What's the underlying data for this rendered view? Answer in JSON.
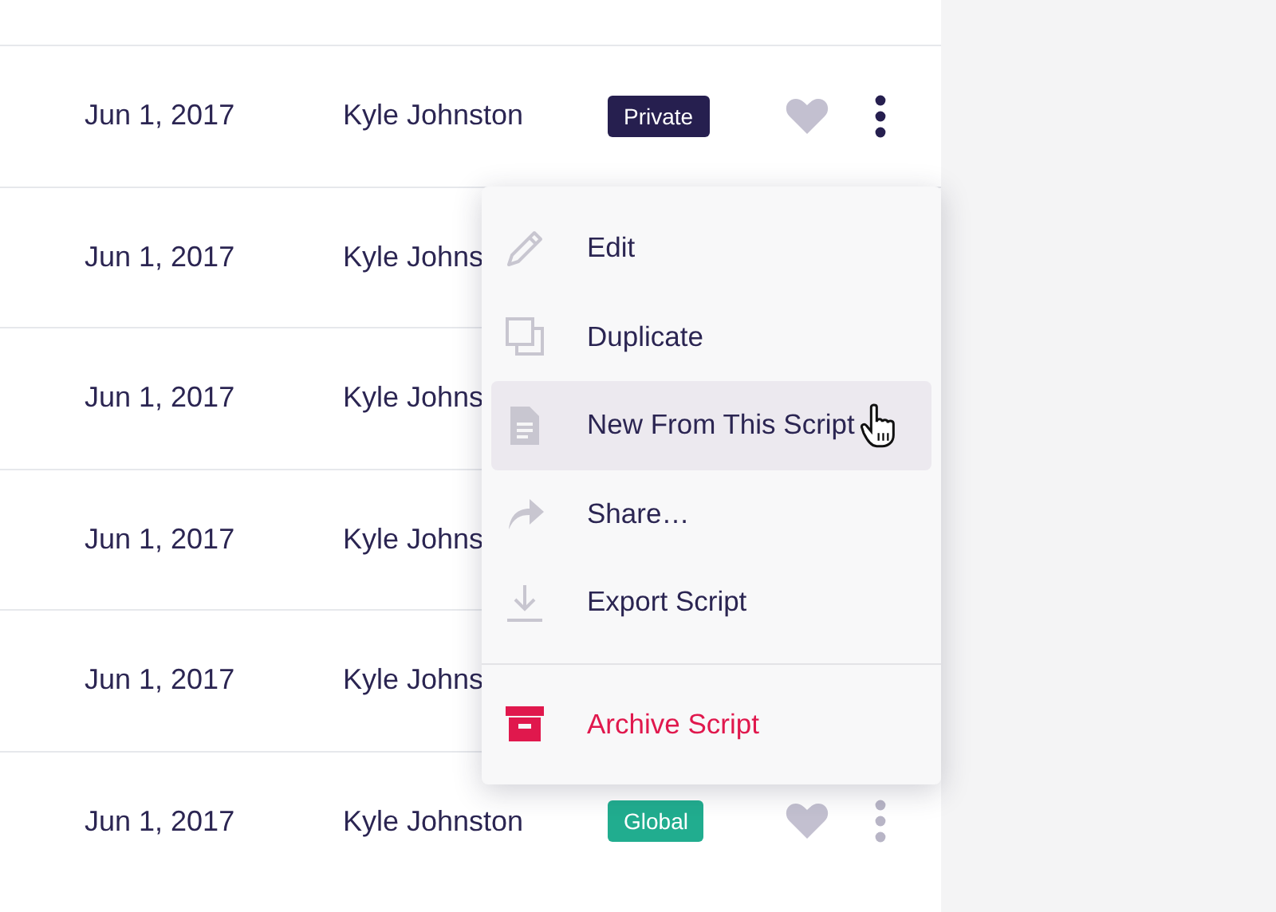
{
  "rows": [
    {
      "date": "Jun 1, 2017",
      "author": "Kyle Johnston",
      "tag": {
        "label": "Private",
        "color": "#261f4f"
      },
      "favorite": false,
      "menu_open": true
    },
    {
      "date": "Jun 1, 2017",
      "author": "Kyle Johns"
    },
    {
      "date": "Jun 1, 2017",
      "author": "Kyle Johns"
    },
    {
      "date": "Jun 1, 2017",
      "author": "Kyle Johns"
    },
    {
      "date": "Jun 1, 2017",
      "author": "Kyle Johns"
    },
    {
      "date": "Jun 1, 2017",
      "author": "Kyle Johnston",
      "tag": {
        "label": "Global",
        "color": "#21ad8f"
      },
      "favorite": false,
      "menu_open": false
    }
  ],
  "menu": {
    "items": [
      {
        "kind": "edit",
        "label": "Edit",
        "selected": false
      },
      {
        "kind": "duplicate",
        "label": "Duplicate",
        "selected": false
      },
      {
        "kind": "new",
        "label": "New From This Script",
        "selected": true
      },
      {
        "kind": "share",
        "label": "Share…",
        "selected": false
      },
      {
        "kind": "export",
        "label": "Export Script",
        "selected": false
      },
      {
        "kind": "archive",
        "label": "Archive Script",
        "selected": false
      }
    ]
  }
}
